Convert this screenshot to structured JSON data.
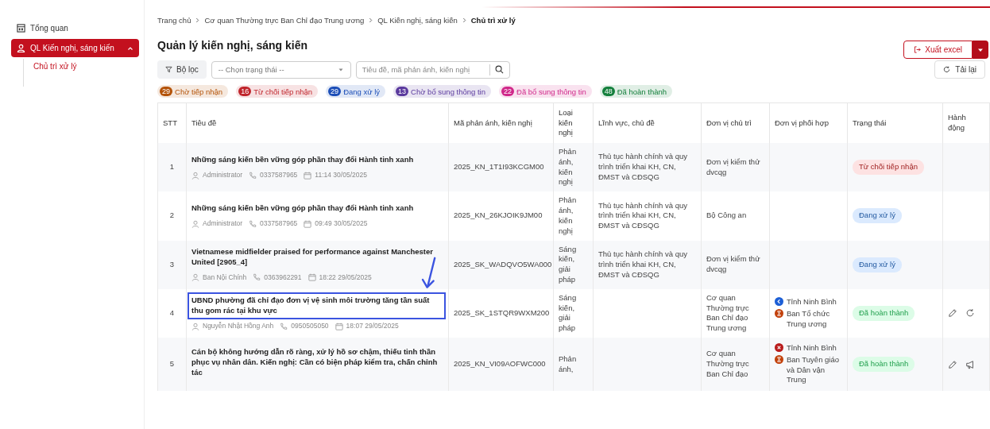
{
  "sidebar": {
    "items": [
      {
        "label": "Tổng quan",
        "selected": false
      },
      {
        "label": "QL Kiến nghị, sáng kiến",
        "selected": true,
        "expanded": true,
        "children": [
          {
            "label": "Chủ trì xử lý",
            "selected": true
          }
        ]
      }
    ]
  },
  "breadcrumb": [
    {
      "label": "Trang chủ",
      "current": false
    },
    {
      "label": "Cơ quan Thường trực Ban Chỉ đạo Trung ương",
      "current": false
    },
    {
      "label": "QL Kiến nghị, sáng kiến",
      "current": false
    },
    {
      "label": "Chủ trì xử lý",
      "current": true
    }
  ],
  "page_title": "Quản lý kiến nghị, sáng kiến",
  "export_button": "Xuất excel",
  "reload_button": "Tải lại",
  "filter_button": "Bộ lọc",
  "status_select": {
    "placeholder": "-- Chọn trạng thái --"
  },
  "search": {
    "placeholder": "Tiêu đề, mã phản ánh, kiến nghị"
  },
  "status_chips": [
    {
      "count": "29",
      "label": "Chờ tiếp nhận",
      "color": "#b45309"
    },
    {
      "count": "16",
      "label": "Từ chối tiếp nhận",
      "color": "#c0262d"
    },
    {
      "count": "29",
      "label": "Đang xử lý",
      "color": "#1d4fb8"
    },
    {
      "count": "13",
      "label": "Chờ bổ sung thông tin",
      "color": "#5b3a9e"
    },
    {
      "count": "22",
      "label": "Đã bổ sung thông tin",
      "color": "#d0288a"
    },
    {
      "count": "48",
      "label": "Đã hoàn thành",
      "color": "#15803d"
    }
  ],
  "table": {
    "columns": [
      "STT",
      "Tiêu đề",
      "Mã phản ánh, kiến nghị",
      "Loại kiến nghị",
      "Lĩnh vực, chủ đề",
      "Đơn vị chủ trì",
      "Đơn vị phối hợp",
      "Trạng thái",
      "Hành động"
    ],
    "rows": [
      {
        "stt": "1",
        "title": "Những sáng kiến bền vững góp phần thay đổi Hành tinh xanh",
        "author": "Administrator",
        "phone": "0337587965",
        "datetime": "11:14 30/05/2025",
        "code": "2025_KN_1T1I93KCGM00",
        "type": "Phản ánh, kiến nghị",
        "field": "Thủ tục hành chính và quy trình triển khai KH, CN, ĐMST và CĐSQG",
        "lead_unit": "Đơn vị kiểm thử dvcqg",
        "coordinating": [],
        "status": {
          "label": "Từ chối tiếp nhận",
          "color": "#fde2e2"
        },
        "actions": [],
        "highlighted": false
      },
      {
        "stt": "2",
        "title": "Những sáng kiến bền vững góp phần thay đổi Hành tinh xanh",
        "author": "Administrator",
        "phone": "0337587965",
        "datetime": "09:49 30/05/2025",
        "code": "2025_KN_26KJOIK9JM00",
        "type": "Phản ánh, kiến nghị",
        "field": "Thủ tục hành chính và quy trình triển khai KH, CN, ĐMST và CĐSQG",
        "lead_unit": "Bộ Công an",
        "coordinating": [],
        "status": {
          "label": "Đang xử lý",
          "color": "#dbeafe"
        },
        "actions": [],
        "highlighted": false
      },
      {
        "stt": "3",
        "title": "Vietnamese midfielder praised for performance against Manchester United [2905_4]",
        "author": "Ban Nội Chính",
        "phone": "0363962291",
        "datetime": "18:22 29/05/2025",
        "code": "2025_SK_WADQVO5WA000",
        "type": "Sáng kiến, giải pháp",
        "field": "Thủ tục hành chính và quy trình triển khai KH, CN, ĐMST và CĐSQG",
        "lead_unit": "Đơn vị kiểm thử dvcqg",
        "coordinating": [],
        "status": {
          "label": "Đang xử lý",
          "color": "#dbeafe"
        },
        "actions": [],
        "highlighted": false
      },
      {
        "stt": "4",
        "title": "UBND phường đã chỉ đạo đơn vị vệ sinh môi trường tăng tần suất thu gom rác tại khu vực",
        "author": "Nguyễn Nhật Hồng Anh",
        "phone": "0950505050",
        "datetime": "18:07 29/05/2025",
        "code": "2025_SK_1STQR9WXM200",
        "type": "Sáng kiến, giải pháp",
        "field": "",
        "lead_unit": "Cơ quan Thường trực Ban Chỉ đạo Trung ương",
        "coordinating": [
          {
            "name": "Tỉnh Ninh Bình",
            "kind": "returned"
          },
          {
            "name": "Ban Tổ chức Trung ương",
            "kind": "waiting"
          }
        ],
        "status": {
          "label": "Đã hoàn thành",
          "color": "#dcfce7"
        },
        "actions": [
          {
            "kind": "edit"
          },
          {
            "kind": "refresh"
          }
        ],
        "highlighted": true
      },
      {
        "stt": "5",
        "title": "Cán bộ không hướng dẫn rõ ràng, xử lý hồ sơ chậm, thiếu tinh thần phục vụ nhân dân. Kiến nghị: Cần có biện pháp kiểm tra, chấn chỉnh tác",
        "code": "2025_KN_VI09AOFWC000",
        "type": "Phản ánh,",
        "field": "",
        "lead_unit": "Cơ quan Thường trực Ban Chỉ đạo",
        "coordinating": [
          {
            "name": "Tỉnh Ninh Bình",
            "kind": "rejected"
          },
          {
            "name": "Ban Tuyên giáo và Dân vận Trung",
            "kind": "waiting"
          }
        ],
        "status": {
          "label": "Đã hoàn thành",
          "color": "#dcfce7"
        },
        "actions": [
          {
            "kind": "edit"
          },
          {
            "kind": "megaphone"
          }
        ],
        "highlighted": false
      }
    ]
  }
}
